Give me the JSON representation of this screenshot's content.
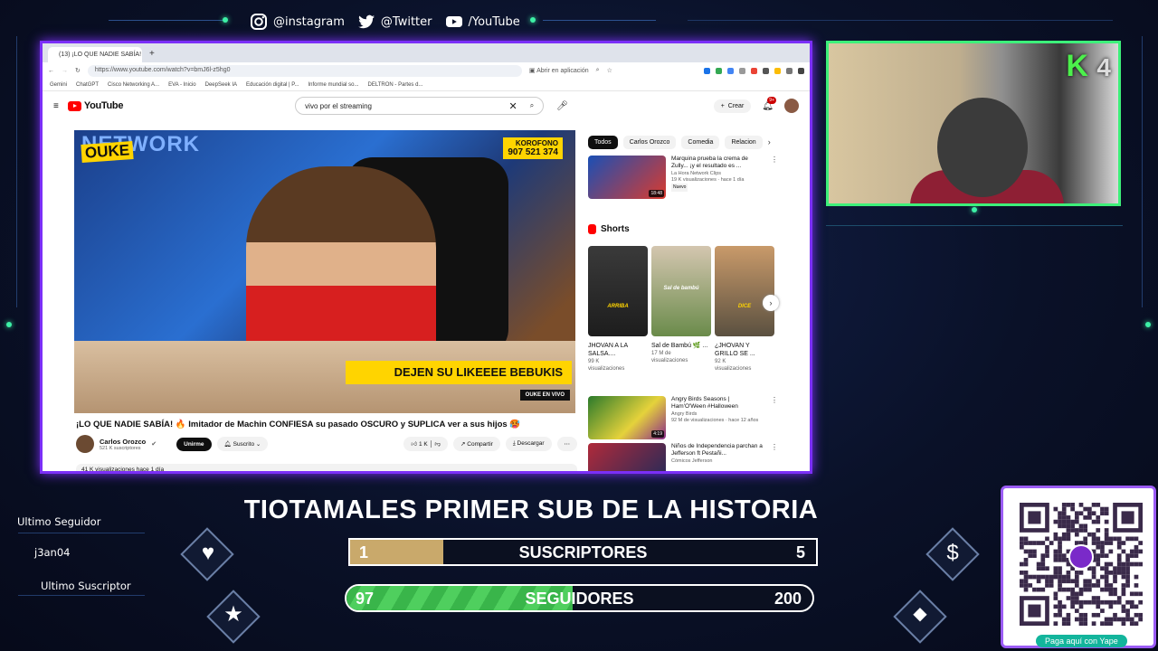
{
  "social": {
    "instagram": "@instagram",
    "twitter": "@Twitter",
    "youtube": "/YouTube"
  },
  "browser": {
    "tab_title": "(13) ¡LO QUE NADIE SABÍA!",
    "url": "https://www.youtube.com/watch?v=bmJ6l-z5hg0",
    "open_in_app": "Abrir en aplicación",
    "bookmarks": [
      "Gemini",
      "ChatGPT",
      "Cisco Networking A...",
      "EVA - Inicio",
      "DeepSeek IA",
      "Educación digital | P...",
      "Informe mundial so...",
      "DELTRON - Partes d..."
    ]
  },
  "youtube": {
    "logo": "YouTube",
    "search_value": "vivo por el streaming",
    "create": "Crear",
    "notif_count": "9+",
    "video": {
      "overlay_network": "NETWORK",
      "overlay_ouke": "OUKE",
      "overlay_phone_label": "KOROFONO",
      "overlay_phone": "907 521 374",
      "overlay_banner": "DEJEN SU LIKEEEE BEBUKIS",
      "overlay_envivo": "OUKE EN VIVO",
      "title": "¡LO QUE NADIE SABÍA! 🔥 Imitador de Machin CONFIESA su pasado OSCURO y SUPLICA ver a sus hijos 🥵",
      "channel": "Carlos Orozco",
      "subscribers": "521 K suscriptores",
      "join": "Unirme",
      "subscribed": "Suscrito",
      "likes": "1 K",
      "share": "Compartir",
      "download": "Descargar",
      "views": "41 K visualizaciones  hace 1 día"
    },
    "chips": [
      "Todos",
      "Carlos Orozco",
      "Comedia",
      "Relacion"
    ],
    "recs_top": [
      {
        "title": "Marquina prueba la crema de Zully... ¡y el resultado es ...",
        "channel": "La Hora Network Clips",
        "stats": "19 K visualizaciones · hace 1 día",
        "badge": "Nuevo",
        "duration": "18:48"
      }
    ],
    "shorts_heading": "Shorts",
    "shorts": [
      {
        "caption": "ARRIBA",
        "title": "JHOVAN A LA SALSA....",
        "views_n": "99 K",
        "views_w": "visualizaciones"
      },
      {
        "caption": "Sal de bambú",
        "title": "Sal de Bambú 🌿 ...",
        "views_n": "17 M de",
        "views_w": "visualizaciones"
      },
      {
        "caption": "DICE",
        "title": "¿JHOVAN Y GRILLO SE ...",
        "views_n": "92 K",
        "views_w": "visualizaciones"
      }
    ],
    "recs_bottom": [
      {
        "title": "Angry Birds Seasons | Ham'O'Ween #Halloween",
        "channel": "Angry Birds",
        "stats": "92 M de visualizaciones · hace 12 años",
        "duration": "4:19"
      },
      {
        "title": "Niños de Independencia parchan a Jefferson ft Pestañi...",
        "channel": "Cómicos Jefferson",
        "stats": "",
        "duration": ""
      }
    ]
  },
  "overlay": {
    "cam_logo": "K",
    "cam_logo_num": "4",
    "goal_title": "TIOTAMALES PRIMER SUB DE LA HISTORIA",
    "subs_bar": {
      "current": "1",
      "label": "SUSCRIPTORES",
      "goal": "5",
      "fraction": 0.2
    },
    "followers_bar": {
      "current": "97",
      "label": "SEGUIDORES",
      "goal": "200",
      "fraction": 0.485
    },
    "last_follower_label": "Ultimo Seguidor",
    "last_follower": "j3an04",
    "last_sub_label": "Ultimo Suscriptor",
    "qr_caption": "Paga aquí con Yape"
  },
  "colors": {
    "browser_border": "#7b2ff7",
    "cam_border": "#3df07a",
    "subs_fill": "#c9a96b",
    "followers_fill": "#39b54a",
    "yape": "#13b59c"
  }
}
